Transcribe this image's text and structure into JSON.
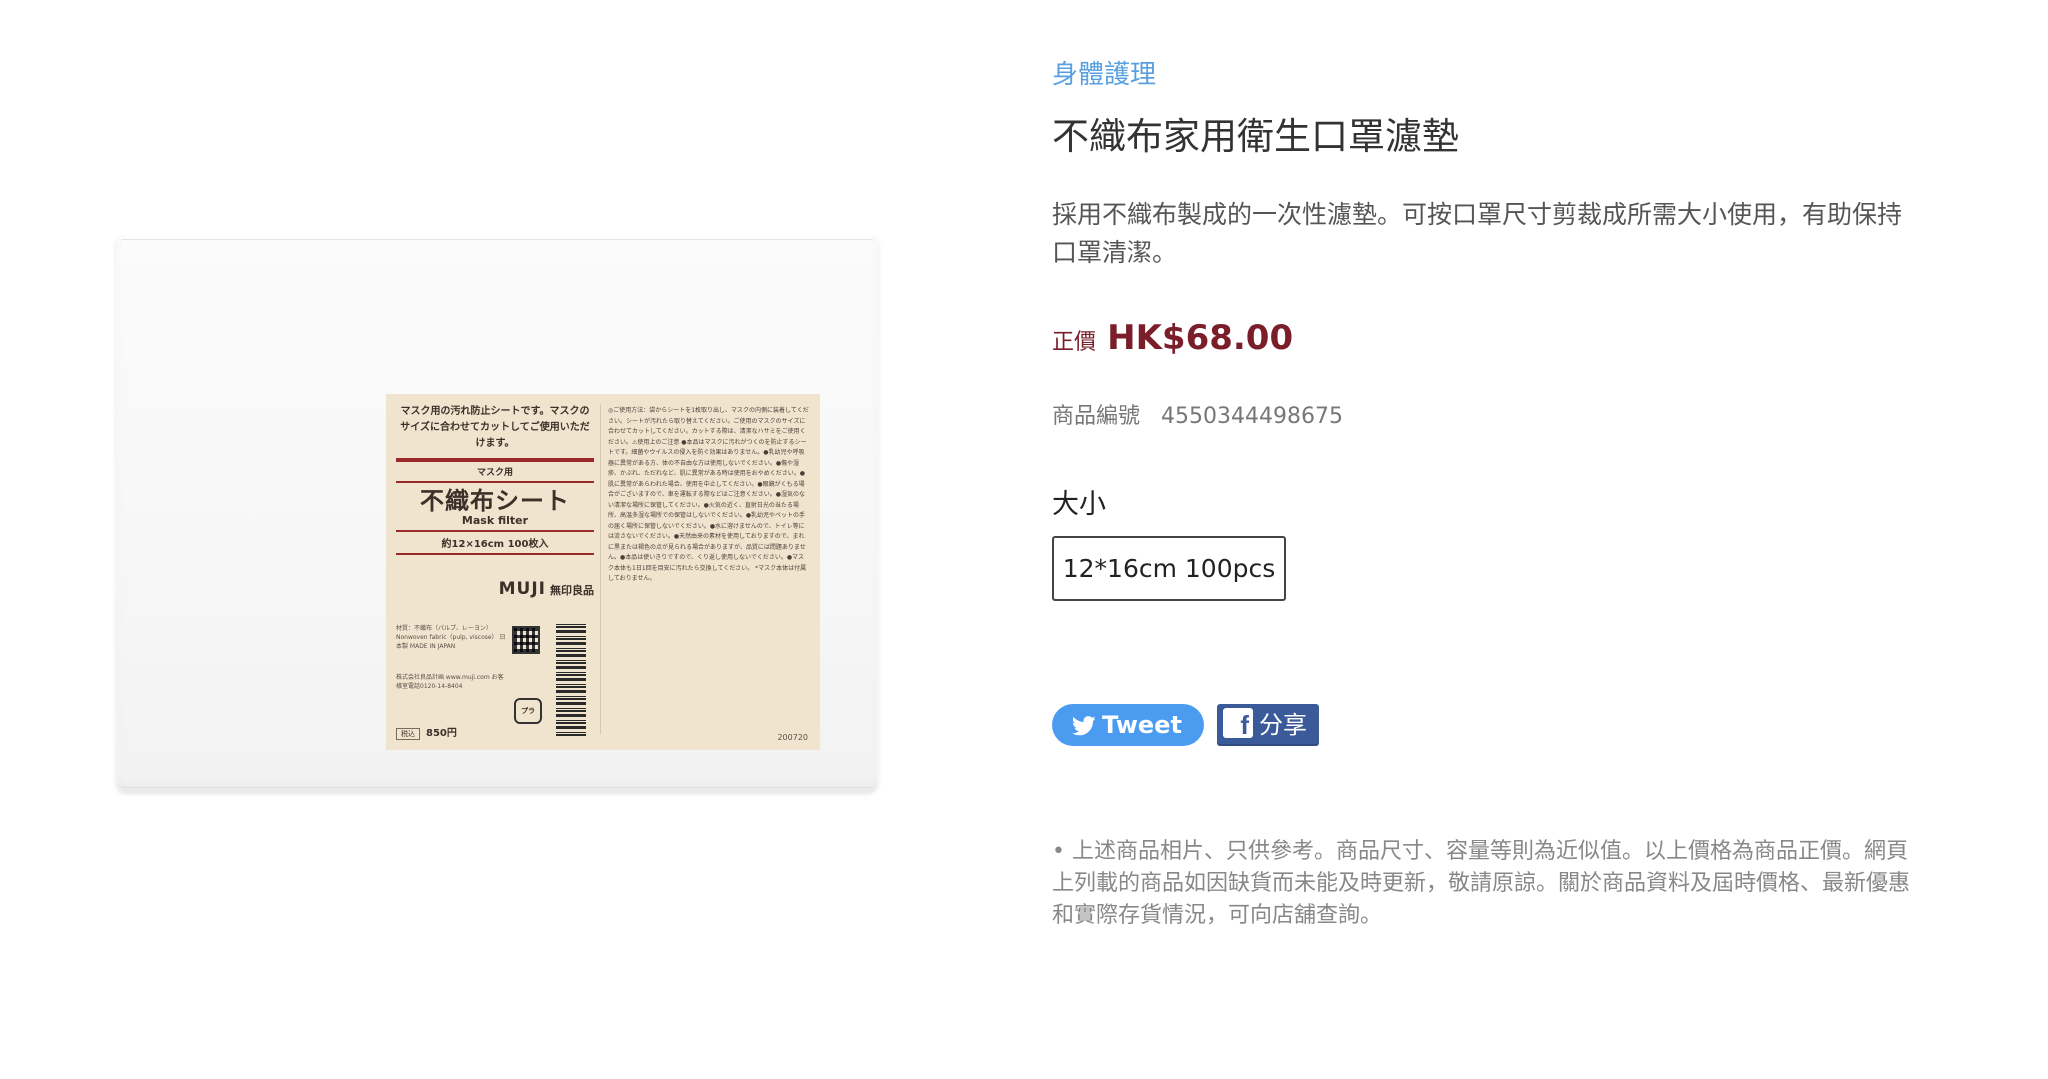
{
  "breadcrumb": {
    "category": "身體護理"
  },
  "product": {
    "title": "不織布家用衛生口罩濾墊",
    "description": "採用不織布製成的一次性濾墊。可按口罩尺寸剪裁成所需大小使用，有助保持口罩清潔。",
    "price_label": "正價",
    "price": "HK$68.00",
    "sku_label": "商品編號",
    "sku": "4550344498675",
    "size_heading": "大小",
    "size_options": [
      "12*16cm 100pcs"
    ],
    "selected_size": "12*16cm 100pcs",
    "disclaimer": "• 上述商品相片、只供參考。商品尺寸、容量等則為近似值。以上價格為商品正價。網頁上列載的商品如因缺貨而未能及時更新，敬請原諒。關於商品資料及屆時價格、最新優惠和實際存貨情況，可向店舖查詢。"
  },
  "share": {
    "tweet_label": "Tweet",
    "facebook_label": "分享"
  },
  "package_label": {
    "intro": "マスク用の汚れ防止シートです。マスクのサイズに合わせてカットしてご使用いただけます。",
    "sub": "マスク用",
    "name_jp": "不織布シート",
    "name_en": "Mask filter",
    "size": "約12×16cm 100枚入",
    "brand": "MUJI",
    "brand_jp": "無印良品",
    "materials": "材質：不織布（パルプ、レーヨン） Nonwoven fabric（pulp, viscose） 日本製 MADE IN JAPAN",
    "maker": "株式会社良品計画 www.muji.com お客様室電話0120-14-8404",
    "price_tag_label": "税込",
    "price_tag": "850円",
    "recycle": "プラ",
    "instructions": "◎ご使用方法：袋からシートを1枚取り出し、マスクの内側に装着してください。シートが汚れたら取り替えてください。ご使用のマスクのサイズに合わせてカットしてください。カットする際は、清潔なハサミをご使用ください。⚠使用上のご注意 ●本品はマスクに汚れがつくのを防止するシートです。細菌やウイルスの侵入を防ぐ効果はありません。●乳幼児や呼吸器に異常がある方、体の不自由な方は使用しないでください。●傷や湿疹、かぶれ、ただれなど、肌に異常がある時は使用をおやめください。●肌に異常があらわれた場合、使用を中止してください。●眼鏡がくもる場合がございますので、車を運転する際などはご注意ください。●湿気のない清潔な場所に保管してください。●火気の近く、直射日光の当たる場所、高温多湿な場所での保管はしないでください。●乳幼児やペットの手の届く場所に保管しないでください。●水に溶けませんので、トイレ等には流さないでください。●天然由来の素材を使用しておりますので、まれに黒または褐色の点が見られる場合がありますが、品質には問題ありません。●本品は使いきりですので、くり返し使用しないでください。●マスク本体も1日1回を目安に汚れたら交換してください。 *マスク本体は付属しておりません。",
    "barcode_digits": "4550344498675",
    "print_code": "200720"
  },
  "colors": {
    "category_link": "#5aa0e0",
    "price": "#7a1e2a",
    "tweet_button": "#4b9cf0",
    "facebook_button": "#3b5a9a"
  },
  "icons": {
    "tweet": "twitter-bird-icon",
    "facebook": "facebook-f-icon"
  }
}
